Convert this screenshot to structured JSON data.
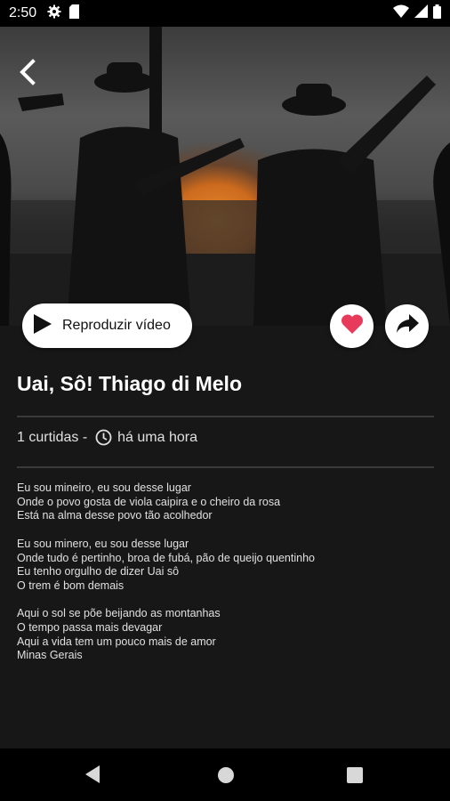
{
  "status_bar": {
    "time": "2:50",
    "icons": [
      "gear-icon",
      "sim-card-icon",
      "wifi-icon",
      "signal-icon",
      "battery-icon"
    ]
  },
  "hero": {
    "description_icon": "video-thumbnail"
  },
  "actions": {
    "play_label": "Reproduzir vídeo",
    "like_icon": "heart-icon",
    "share_icon": "share-icon",
    "accent_color": "#e83a5a"
  },
  "song": {
    "title": "Uai, Sô! Thiago di Melo",
    "likes": "1 curtidas -",
    "time_ago": "há uma hora"
  },
  "lyrics": {
    "stanzas": [
      [
        "Eu sou mineiro, eu sou desse lugar",
        "Onde o povo gosta de viola caipira e o cheiro da rosa",
        "Está na alma desse povo tão acolhedor"
      ],
      [
        "Eu sou minero, eu sou desse lugar",
        "Onde tudo é pertinho, broa de fubá, pão de queijo quentinho",
        "Eu tenho orgulho de dizer Uai sô",
        "O trem é bom demais"
      ],
      [
        "Aqui o sol se põe beijando as montanhas",
        "O tempo passa mais devagar",
        "Aqui a vida tem um pouco mais de amor",
        "Minas Gerais"
      ]
    ]
  },
  "nav_bar": {
    "icons": [
      "back-triangle-icon",
      "home-circle-icon",
      "recents-square-icon"
    ]
  }
}
